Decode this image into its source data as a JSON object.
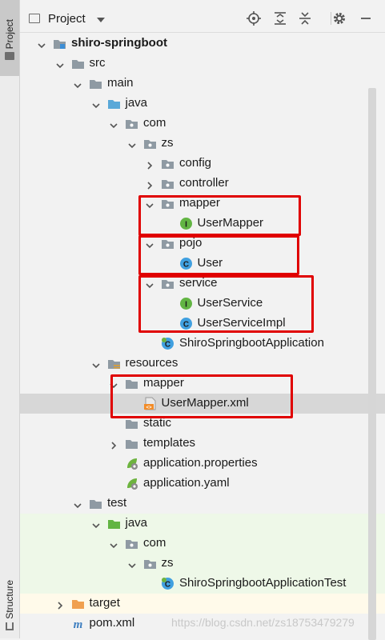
{
  "sidebar": {
    "project_tab": "Project",
    "structure_tab": "Structure"
  },
  "header": {
    "title": "Project",
    "buttons": [
      "locate-icon",
      "expand-all-icon",
      "collapse-all-icon",
      "gear-icon",
      "hide-icon"
    ]
  },
  "tree": {
    "rows": [
      {
        "label": "shiro-springboot",
        "depth": 0,
        "expanded": true,
        "icon": "module-folder-icon",
        "bold": true
      },
      {
        "label": "src",
        "depth": 1,
        "expanded": true,
        "icon": "folder-icon"
      },
      {
        "label": "main",
        "depth": 2,
        "expanded": true,
        "icon": "folder-icon"
      },
      {
        "label": "java",
        "depth": 3,
        "expanded": true,
        "icon": "source-root-icon"
      },
      {
        "label": "com",
        "depth": 4,
        "expanded": true,
        "icon": "package-icon"
      },
      {
        "label": "zs",
        "depth": 5,
        "expanded": true,
        "icon": "package-icon"
      },
      {
        "label": "config",
        "depth": 6,
        "expanded": false,
        "icon": "package-icon"
      },
      {
        "label": "controller",
        "depth": 6,
        "expanded": false,
        "icon": "package-icon"
      },
      {
        "label": "mapper",
        "depth": 6,
        "expanded": true,
        "icon": "package-icon"
      },
      {
        "label": "UserMapper",
        "depth": 7,
        "icon": "interface-icon"
      },
      {
        "label": "pojo",
        "depth": 6,
        "expanded": true,
        "icon": "package-icon"
      },
      {
        "label": "User",
        "depth": 7,
        "icon": "class-icon"
      },
      {
        "label": "service",
        "depth": 6,
        "expanded": true,
        "icon": "package-icon"
      },
      {
        "label": "UserService",
        "depth": 7,
        "icon": "interface-icon"
      },
      {
        "label": "UserServiceImpl",
        "depth": 7,
        "icon": "class-icon"
      },
      {
        "label": "ShiroSpringbootApplication",
        "depth": 6,
        "icon": "spring-boot-class-icon"
      },
      {
        "label": "resources",
        "depth": 3,
        "expanded": true,
        "icon": "resources-root-icon"
      },
      {
        "label": "mapper",
        "depth": 4,
        "expanded": true,
        "icon": "folder-icon"
      },
      {
        "label": "UserMapper.xml",
        "depth": 5,
        "icon": "xml-file-icon",
        "selected": true
      },
      {
        "label": "static",
        "depth": 4,
        "icon": "folder-icon"
      },
      {
        "label": "templates",
        "depth": 4,
        "expanded": false,
        "icon": "folder-icon"
      },
      {
        "label": "application.properties",
        "depth": 4,
        "icon": "spring-properties-icon"
      },
      {
        "label": "application.yaml",
        "depth": 4,
        "icon": "spring-yaml-icon"
      },
      {
        "label": "test",
        "depth": 2,
        "expanded": true,
        "icon": "folder-icon"
      },
      {
        "label": "java",
        "depth": 3,
        "expanded": true,
        "icon": "test-root-icon",
        "test": true
      },
      {
        "label": "com",
        "depth": 4,
        "expanded": true,
        "icon": "package-icon",
        "test": true
      },
      {
        "label": "zs",
        "depth": 5,
        "expanded": true,
        "icon": "package-icon",
        "test": true
      },
      {
        "label": "ShiroSpringbootApplicationTest",
        "depth": 6,
        "icon": "spring-boot-class-icon",
        "test": true
      },
      {
        "label": "target",
        "depth": 1,
        "expanded": false,
        "icon": "excluded-folder-icon",
        "lib": true
      },
      {
        "label": "pom.xml",
        "depth": 1,
        "icon": "maven-icon"
      }
    ]
  },
  "watermark": "https://blog.csdn.net/zs18753479279",
  "colors": {
    "highlight": "#e00000",
    "selection": "#d7d7d7",
    "test_background": "#eef8e8",
    "folder": "#8f9aa3",
    "source_root": "#59a8d8",
    "test_root": "#62b543",
    "interface": "#62b543",
    "class": "#40a0e0"
  }
}
